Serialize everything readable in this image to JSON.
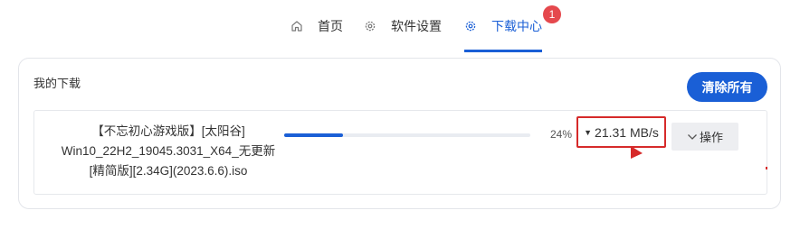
{
  "nav": {
    "items": [
      {
        "label": "首页",
        "icon": "home-icon"
      },
      {
        "label": "软件设置",
        "icon": "gear-icon"
      },
      {
        "label": "下载中心",
        "icon": "gear-icon",
        "active": true
      }
    ],
    "badge": "1"
  },
  "downloads": {
    "title": "我的下载",
    "clear_all_label": "清除所有",
    "tasks": [
      {
        "name_lines": [
          "【不忘初心游戏版】[太阳谷]",
          "Win10_22H2_19045.3031_X64_无更新",
          "[精简版][2.34G](2023.6.6).iso"
        ],
        "progress": 0.24,
        "percent_label": "24%",
        "speed": "21.31 MB/s",
        "speed_caret": "▼",
        "actions_label": "操作"
      }
    ]
  },
  "colors": {
    "accent": "#1a5fd6",
    "badge": "#e5484d",
    "highlight": "#d62a2a"
  }
}
